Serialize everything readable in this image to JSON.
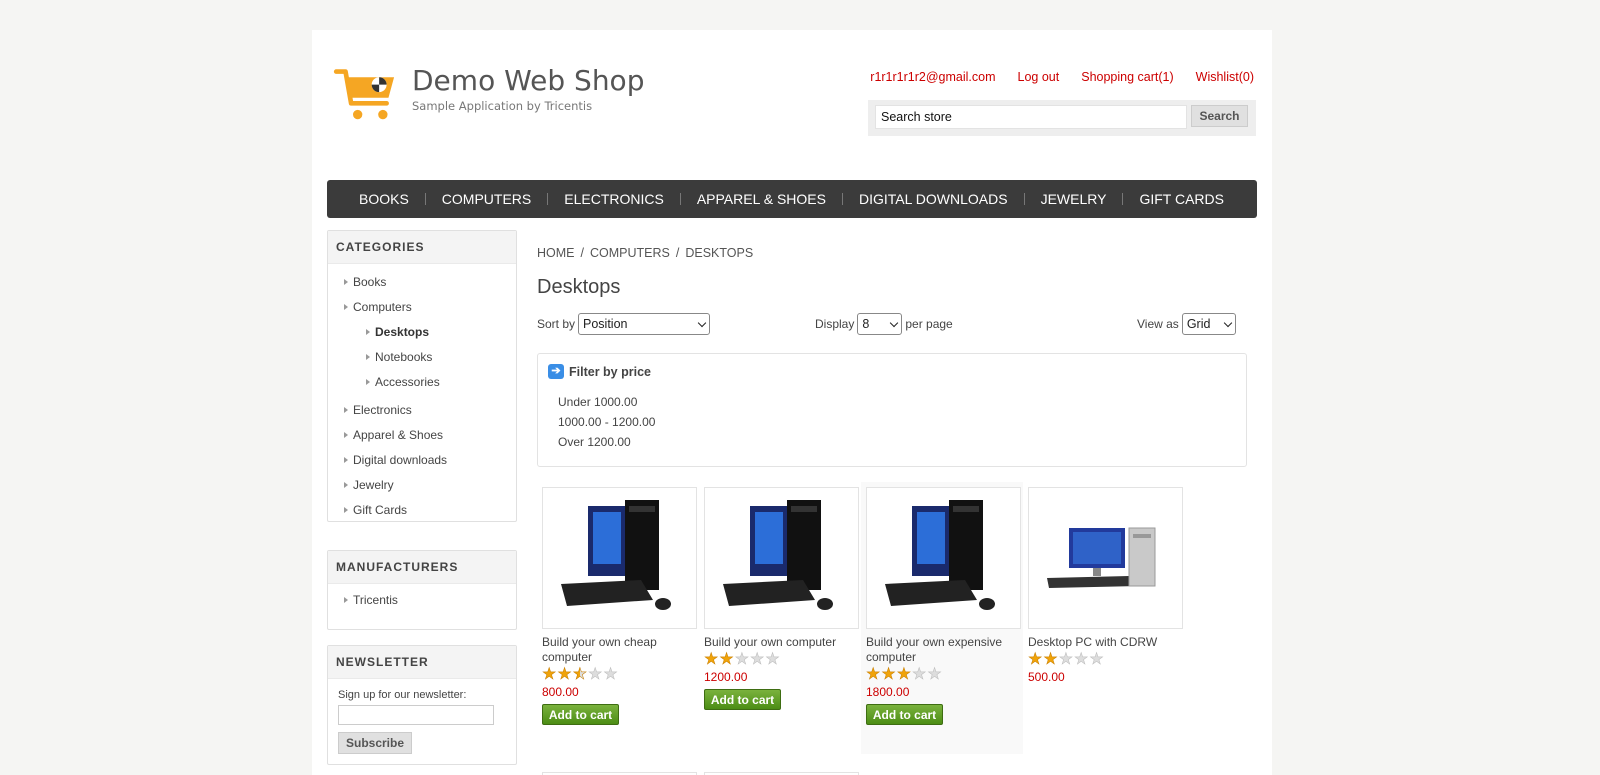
{
  "header": {
    "logo_title": "Demo Web Shop",
    "logo_subtitle": "Sample Application by Tricentis",
    "account_email": "r1r1r1r1r2@gmail.com",
    "logout": "Log out",
    "cart": "Shopping cart(1)",
    "wishlist": "Wishlist(0)",
    "search_value": "Search store",
    "search_button": "Search"
  },
  "menu": [
    "BOOKS",
    "COMPUTERS",
    "ELECTRONICS",
    "APPAREL & SHOES",
    "DIGITAL DOWNLOADS",
    "JEWELRY",
    "GIFT CARDS"
  ],
  "categories": {
    "title": "CATEGORIES",
    "items": [
      "Books",
      "Computers",
      "Desktops",
      "Notebooks",
      "Accessories",
      "Electronics",
      "Apparel & Shoes",
      "Digital downloads",
      "Jewelry",
      "Gift Cards"
    ]
  },
  "manufacturers": {
    "title": "MANUFACTURERS",
    "items": [
      "Tricentis"
    ]
  },
  "newsletter": {
    "title": "NEWSLETTER",
    "label": "Sign up for our newsletter:",
    "button": "Subscribe"
  },
  "breadcrumb": [
    "HOME",
    "/",
    "COMPUTERS",
    "/",
    "DESKTOPS"
  ],
  "page_title": "Desktops",
  "controls": {
    "sort_label": "Sort by",
    "sort_value": "Position",
    "display_label": "Display",
    "display_value": "8",
    "per_page": "per page",
    "view_label": "View as",
    "view_value": "Grid"
  },
  "filter": {
    "title": "Filter by price",
    "options": [
      "Under 1000.00",
      "1000.00 - 1200.00",
      "Over 1200.00"
    ]
  },
  "products": [
    {
      "title": "Build your own cheap computer",
      "rating": 2.5,
      "price": "800.00",
      "button": "Add to cart"
    },
    {
      "title": "Build your own computer",
      "rating": 2,
      "price": "1200.00",
      "button": "Add to cart"
    },
    {
      "title": "Build your own expensive computer",
      "rating": 3,
      "price": "1800.00",
      "button": "Add to cart"
    },
    {
      "title": "Desktop PC with CDRW",
      "rating": 2,
      "price": "500.00"
    }
  ]
}
